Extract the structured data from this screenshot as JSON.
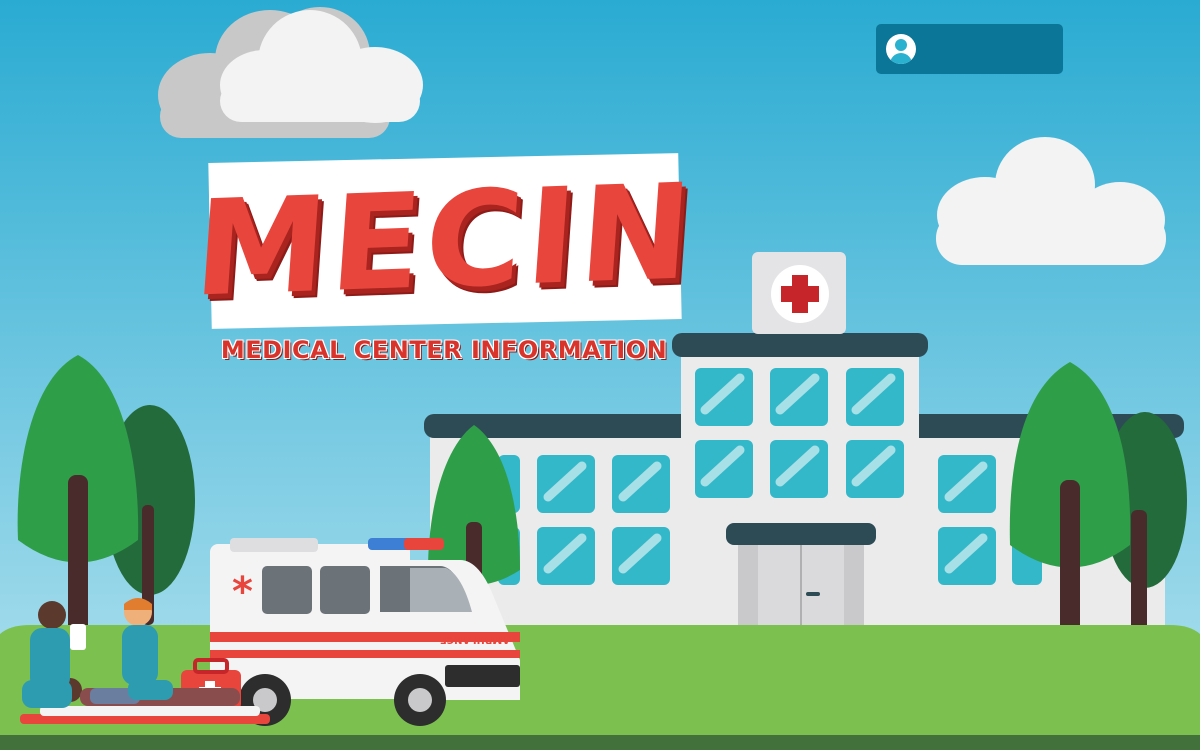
{
  "header": {
    "user_button": {
      "icon": "user-avatar-icon",
      "label": ""
    }
  },
  "logo": {
    "title": "MECIN",
    "subtitle": "MEDICAL CENTER INFORMATION"
  },
  "illustration": {
    "ambulance_sign": "AMBULANCE",
    "colors": {
      "sky_top": "#2aabd2",
      "sky_bottom": "#b3e2ef",
      "grass": "#7cc150",
      "brand_red": "#e8453c",
      "button_teal": "#0b7698",
      "window_teal": "#33b8c9"
    }
  }
}
